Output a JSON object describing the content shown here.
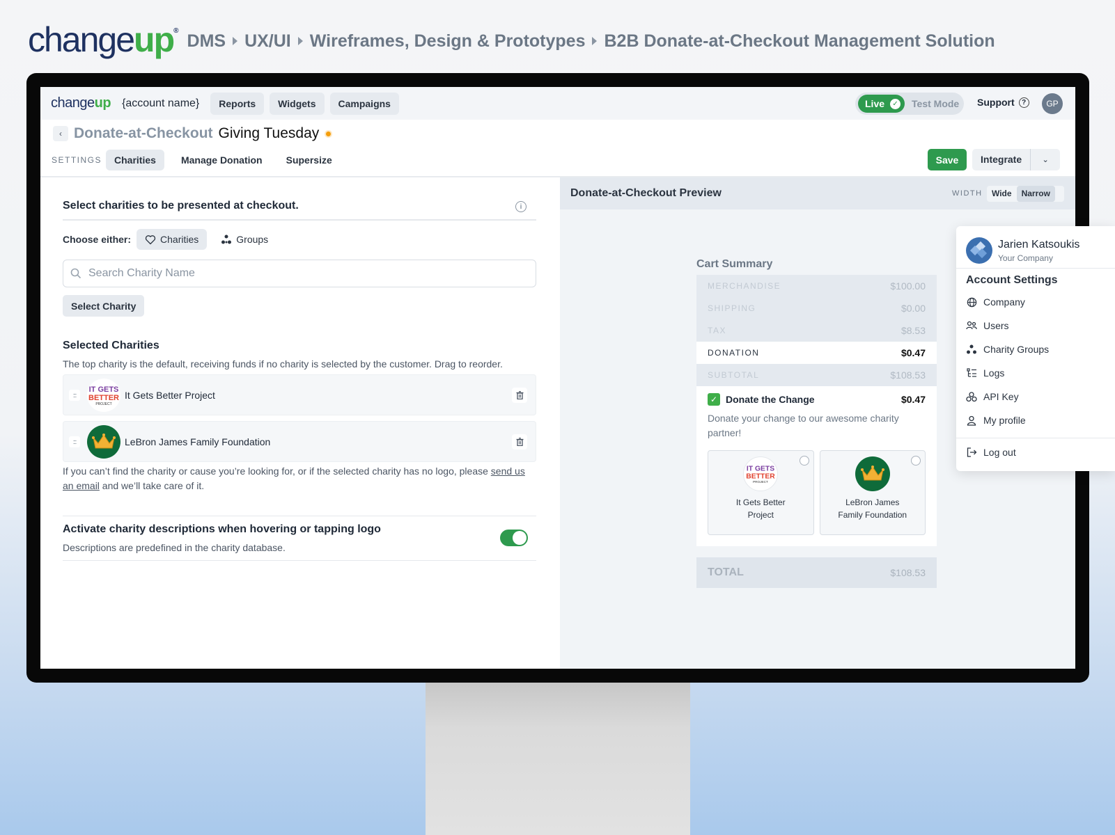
{
  "header": {
    "brand_change": "change",
    "brand_up": "up",
    "brand_reg": "®",
    "breadcrumbs": [
      "DMS",
      "UX/UI",
      "Wireframes, Design & Prototypes",
      "B2B Donate-at-Checkout Management Solution"
    ]
  },
  "topnav": {
    "logo_change": "change",
    "logo_up": "up",
    "account_name": "{account name}",
    "items": [
      "Reports",
      "Widgets",
      "Campaigns"
    ],
    "mode_live": "Live",
    "mode_test": "Test Mode",
    "support": "Support",
    "avatar_initials": "GP"
  },
  "title": {
    "main": "Donate-at-Checkout",
    "sub": "Giving Tuesday"
  },
  "tabs": {
    "settings_label": "SETTINGS",
    "items": [
      "Charities",
      "Manage Donation",
      "Supersize"
    ],
    "active": "Charities",
    "save": "Save",
    "integrate": "Integrate"
  },
  "left": {
    "heading": "Select charities to be presented at checkout.",
    "choose_label": "Choose either:",
    "choice_charities": "Charities",
    "choice_groups": "Groups",
    "search_placeholder": "Search Charity Name",
    "select_button": "Select Charity",
    "selected_title": "Selected Charities",
    "selected_desc": "The top charity is the default, receiving funds if no charity is selected by the customer. Drag to reorder.",
    "charities": [
      {
        "name": "It Gets Better Project",
        "logo_text": "IT GETS BETTER PROJECT"
      },
      {
        "name": "LeBron James Family Foundation",
        "logo_text": ""
      }
    ],
    "note_before": "If you can’t find the charity or cause you’re looking for, or if the selected charity has no logo, please ",
    "note_link": "send us an email",
    "note_after": " and we’ll take care of it.",
    "activate_title": "Activate charity descriptions when hovering or tapping logo",
    "activate_desc": "Descriptions are predefined in the charity database.",
    "activate_on": true
  },
  "preview": {
    "title": "Donate-at-Checkout Preview",
    "width_label": "WIDTH",
    "width_wide": "Wide",
    "width_narrow": "Narrow",
    "width_selected": "Narrow",
    "cart_title": "Cart Summary",
    "rows": [
      {
        "label": "MERCHANDISE",
        "value": "$100.00"
      },
      {
        "label": "SHIPPING",
        "value": "$0.00"
      },
      {
        "label": "TAX",
        "value": "$8.53"
      }
    ],
    "donation": {
      "label": "DONATION",
      "value": "$0.47"
    },
    "subtotal": {
      "label": "SUBTOTAL",
      "value": "$108.53"
    },
    "donate_label": "Donate the Change",
    "donate_amount": "$0.47",
    "donate_desc": "Donate your change to our awesome charity partner!",
    "cards": [
      {
        "name": "It Gets Better Project"
      },
      {
        "name": "LeBron James Family Foundation"
      }
    ],
    "total": {
      "label": "TOTAL",
      "value": "$108.53"
    }
  },
  "dropdown": {
    "user_name": "Jarien Katsoukis",
    "company": "Your Company",
    "heading": "Account Settings",
    "items": [
      "Company",
      "Users",
      "Charity Groups",
      "Logs",
      "API Key",
      "My profile"
    ],
    "logout": "Log out"
  },
  "colors": {
    "brand_navy": "#1e3160",
    "brand_green": "#3fae49",
    "live_green": "#2e9a4e",
    "status_orange": "#f59e0b"
  }
}
